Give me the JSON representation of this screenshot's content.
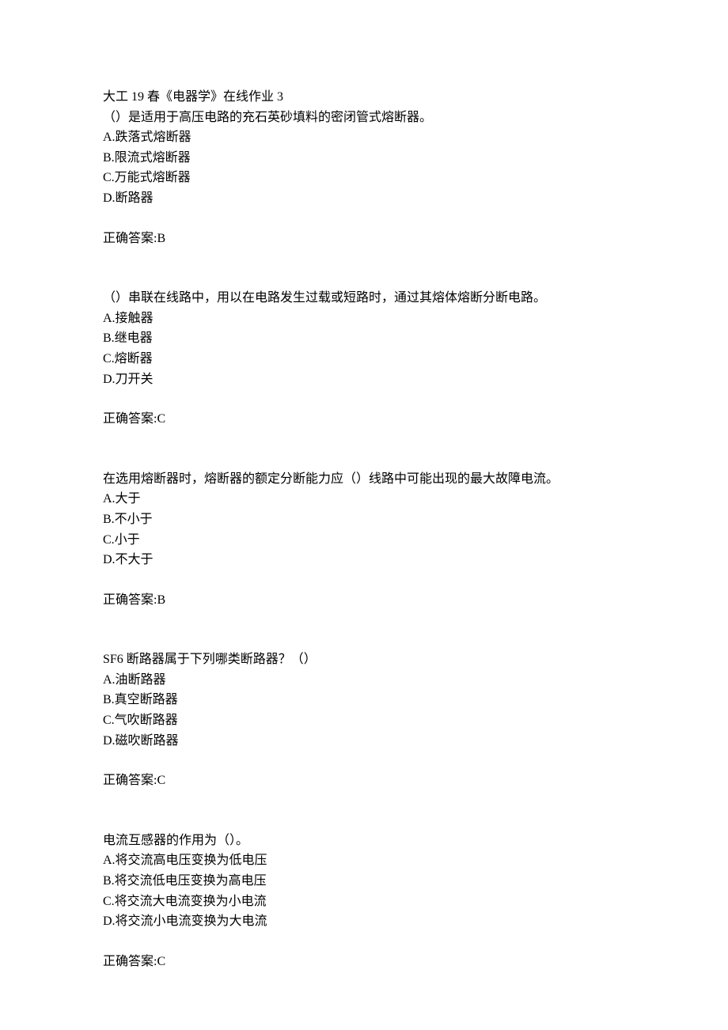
{
  "title": "大工 19 春《电器学》在线作业 3",
  "questions": [
    {
      "text": "（）是适用于高压电路的充石英砂填料的密闭管式熔断器。",
      "options": [
        "A.跌落式熔断器",
        "B.限流式熔断器",
        "C.万能式熔断器",
        "D.断路器"
      ],
      "answer": "正确答案:B"
    },
    {
      "text": "（）串联在线路中，用以在电路发生过载或短路时，通过其熔体熔断分断电路。",
      "options": [
        "A.接触器",
        "B.继电器",
        "C.熔断器",
        "D.刀开关"
      ],
      "answer": "正确答案:C"
    },
    {
      "text": "在选用熔断器时，熔断器的额定分断能力应（）线路中可能出现的最大故障电流。",
      "options": [
        "A.大于",
        "B.不小于",
        "C.小于",
        "D.不大于"
      ],
      "answer": "正确答案:B"
    },
    {
      "text": "SF6 断路器属于下列哪类断路器？（）",
      "options": [
        "A.油断路器",
        "B.真空断路器",
        "C.气吹断路器",
        "D.磁吹断路器"
      ],
      "answer": "正确答案:C"
    },
    {
      "text": "电流互感器的作用为（）。",
      "options": [
        "A.将交流高电压变换为低电压",
        "B.将交流低电压变换为高电压",
        "C.将交流大电流变换为小电流",
        "D.将交流小电流变换为大电流"
      ],
      "answer": "正确答案:C"
    }
  ]
}
